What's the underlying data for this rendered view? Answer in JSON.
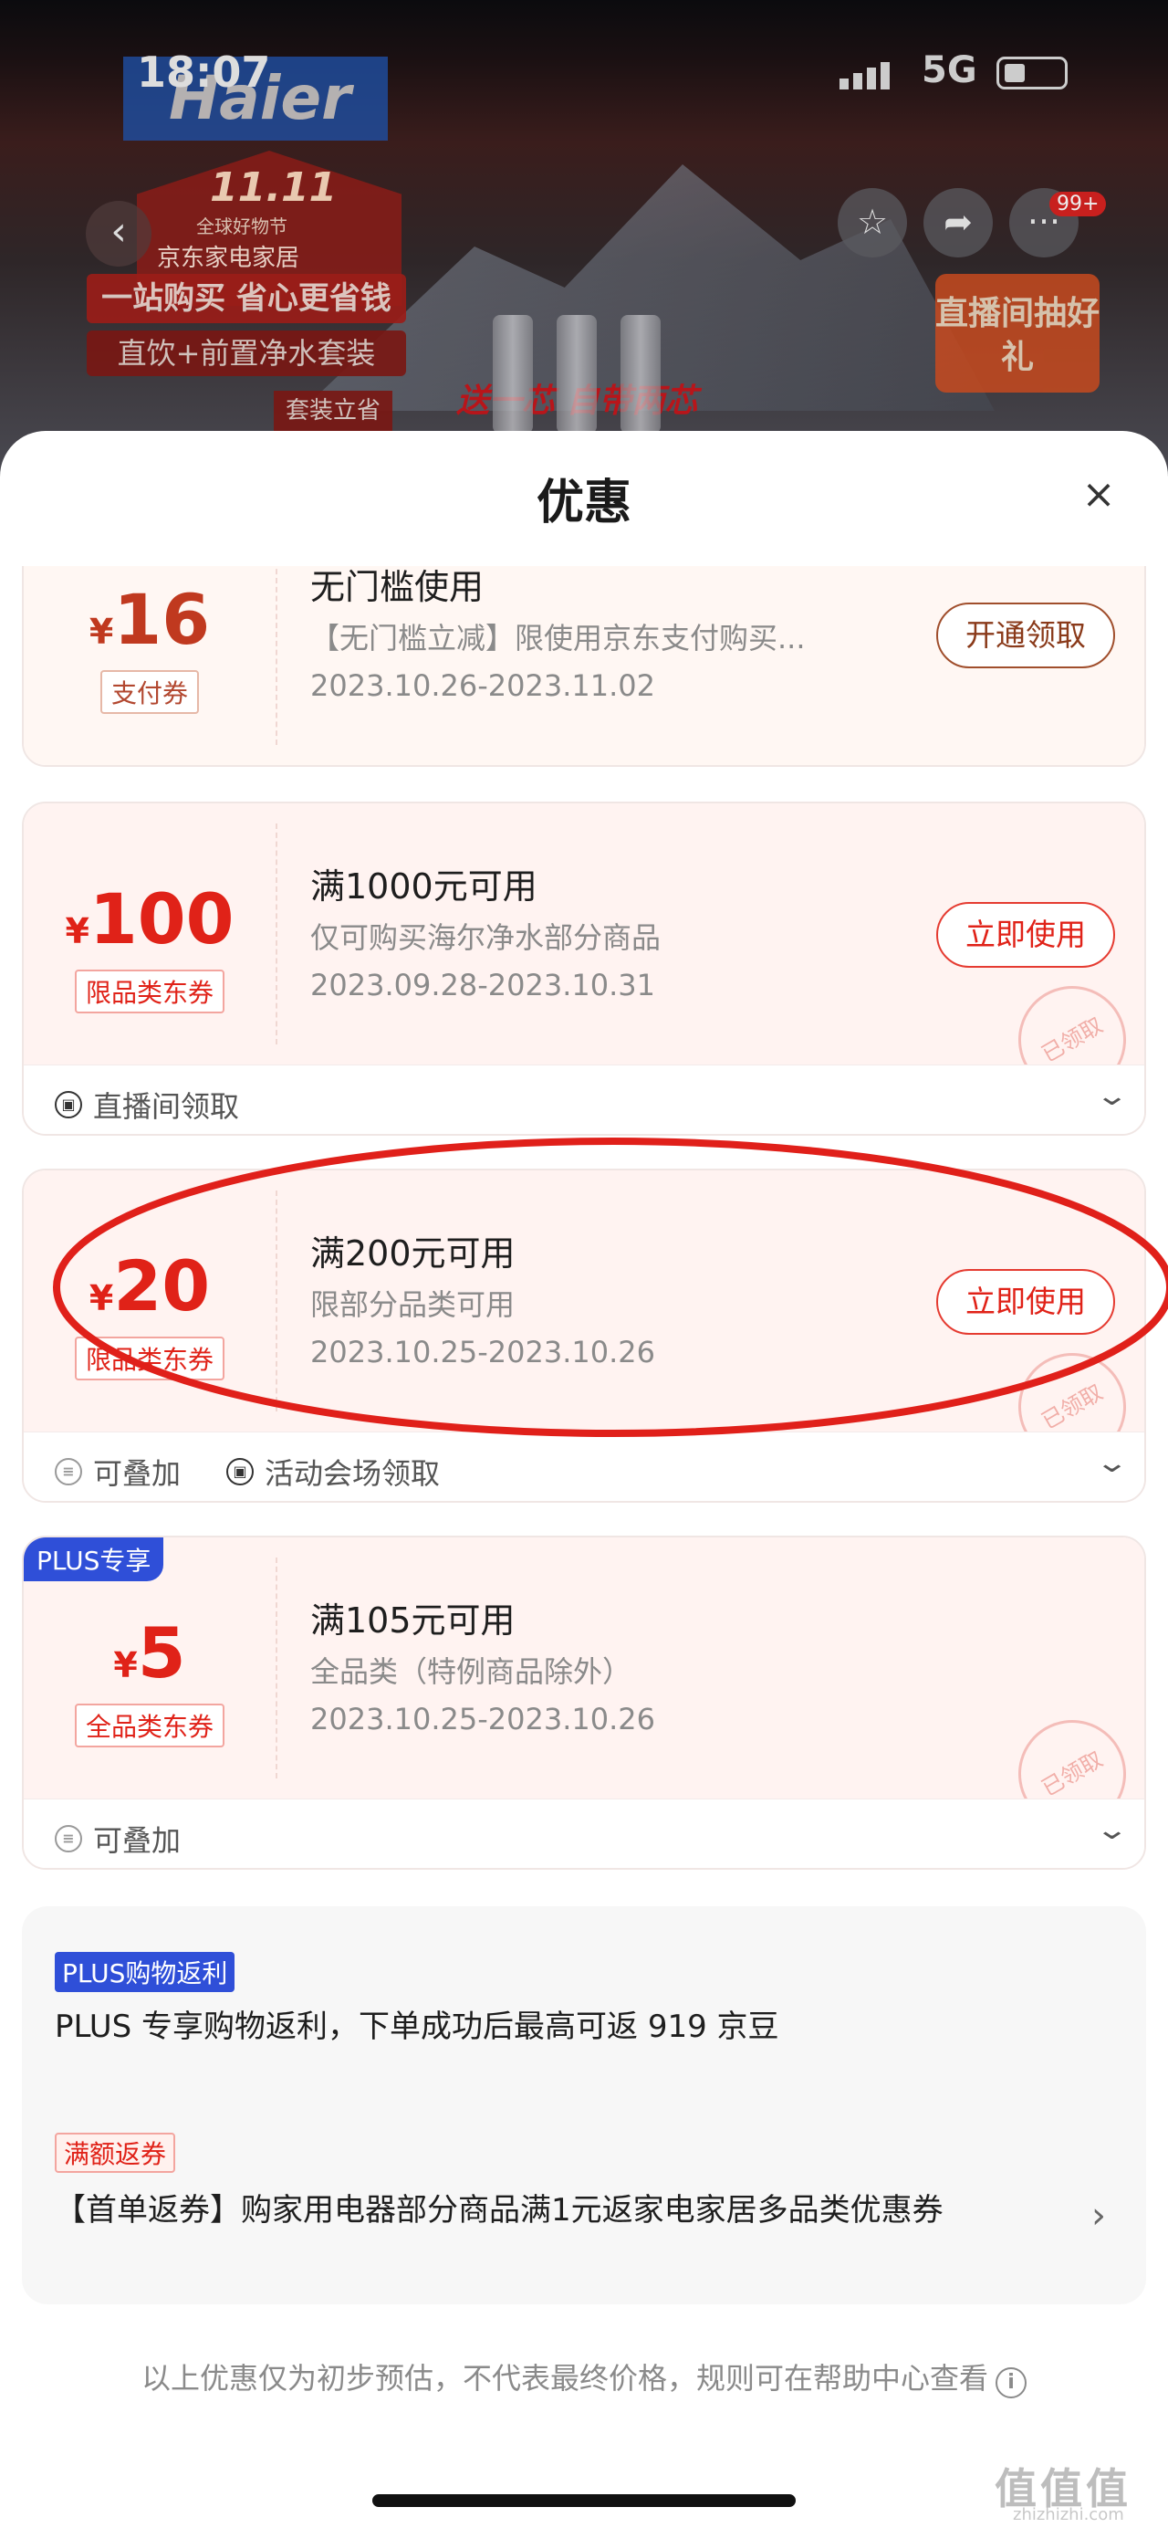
{
  "status_bar": {
    "time": "18:07",
    "network": "5G"
  },
  "background_page": {
    "brand": "Haier",
    "promo_1111": "11.11",
    "promo_subtitle": "全球好物节",
    "promo_category": "京东家电家居",
    "promo_line1": "一站购买 省心更省钱",
    "promo_line2": "直饮+前置净水套装",
    "promo_sale": "套装立省",
    "promo_tag": "送一芯 自带两芯",
    "live_badge": "直播间抽好礼",
    "badge_count": "99+"
  },
  "sheet": {
    "title": "优惠",
    "close_icon": "×"
  },
  "coupons": [
    {
      "currency": "¥",
      "amount": "16",
      "type": "支付券",
      "title": "无门槛使用",
      "desc": "【无门槛立减】限使用京东支付购买...",
      "date": "2023.10.26-2023.11.02",
      "action": "开通领取"
    },
    {
      "currency": "¥",
      "amount": "100",
      "type": "限品类东券",
      "title": "满1000元可用",
      "desc": "仅可购买海尔净水部分商品",
      "date": "2023.09.28-2023.10.31",
      "action": "立即使用",
      "stamp": "已领取",
      "foot": [
        "直播间领取"
      ]
    },
    {
      "currency": "¥",
      "amount": "20",
      "type": "限品类东券",
      "title": "满200元可用",
      "desc": "限部分品类可用",
      "date": "2023.10.25-2023.10.26",
      "action": "立即使用",
      "stamp": "已领取",
      "foot": [
        "可叠加",
        "活动会场领取"
      ]
    },
    {
      "badge": "PLUS专享",
      "currency": "¥",
      "amount": "5",
      "type": "全品类东券",
      "title": "满105元可用",
      "desc": "全品类（特例商品除外）",
      "date": "2023.10.25-2023.10.26",
      "stamp": "已领取",
      "foot": [
        "可叠加"
      ]
    }
  ],
  "info": {
    "plus_badge": "PLUS购物返利",
    "plus_text": "PLUS 专享购物返利，下单成功后最高可返 919 京豆",
    "return_badge": "满额返券",
    "return_text": "【首单返券】购家用电器部分商品满1元返家电家居多品类优惠券"
  },
  "disclaimer": "以上优惠仅为初步预估，不代表最终价格，规则可在帮助中心查看",
  "watermark": "值值值",
  "watermark_sub": "zhizhizhi.com",
  "colors": {
    "accent": "#e02218",
    "plus_blue": "#2f4fd8",
    "highlight_circle": "#e0201a"
  }
}
